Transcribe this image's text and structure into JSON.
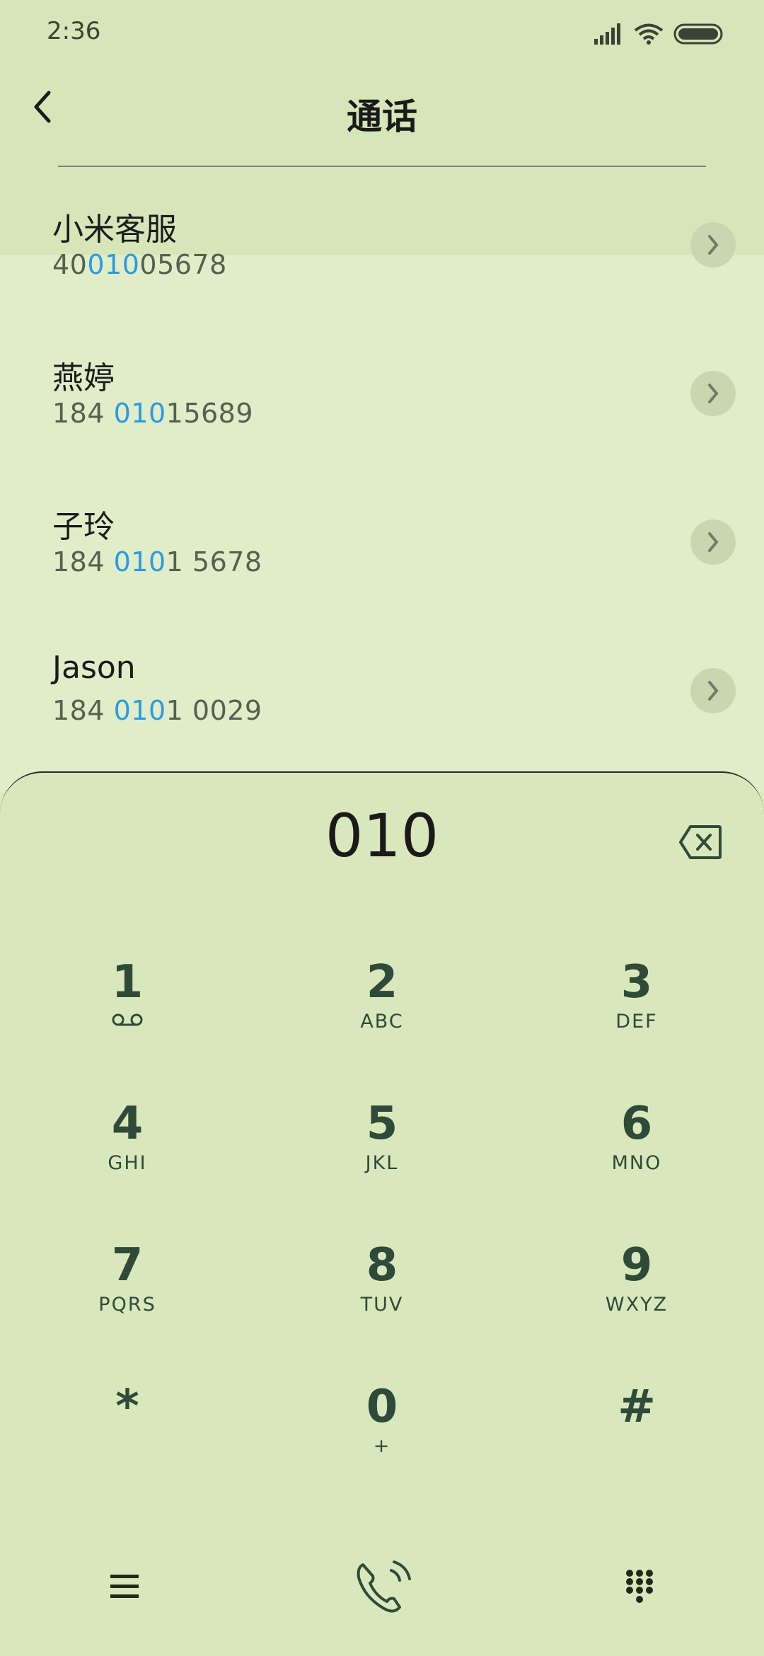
{
  "status_bar": {
    "time": "2:36"
  },
  "header": {
    "title": "通话"
  },
  "contacts": [
    {
      "name": "小米客服",
      "number_before": "40",
      "number_match": "010",
      "number_after": "05678"
    },
    {
      "name": "燕婷",
      "number_before": "184 ",
      "number_match": "010",
      "number_after": "15689"
    },
    {
      "name": "子玲",
      "number_before": "184 ",
      "number_match": "010",
      "number_after": "1 5678"
    },
    {
      "name": "Jason",
      "number_before": "184 ",
      "number_match": "010",
      "number_after": "1 0029"
    }
  ],
  "dialer": {
    "entered": "010",
    "keys": [
      {
        "digit": "1",
        "letters": ""
      },
      {
        "digit": "2",
        "letters": "ABC"
      },
      {
        "digit": "3",
        "letters": "DEF"
      },
      {
        "digit": "4",
        "letters": "GHI"
      },
      {
        "digit": "5",
        "letters": "JKL"
      },
      {
        "digit": "6",
        "letters": "MNO"
      },
      {
        "digit": "7",
        "letters": "PQRS"
      },
      {
        "digit": "8",
        "letters": "TUV"
      },
      {
        "digit": "9",
        "letters": "WXYZ"
      },
      {
        "digit": "*",
        "letters": ""
      },
      {
        "digit": "0",
        "letters": "+"
      },
      {
        "digit": "#",
        "letters": ""
      }
    ]
  },
  "colors": {
    "accent": "#2a9be0",
    "background": "#dbe9bf",
    "key_text": "#2f4a38"
  },
  "icons": [
    "back-chevron-icon",
    "signal-icon",
    "wifi-icon",
    "battery-icon",
    "chevron-right-icon",
    "backspace-icon",
    "voicemail-icon",
    "menu-icon",
    "call-icon",
    "dialpad-icon"
  ]
}
